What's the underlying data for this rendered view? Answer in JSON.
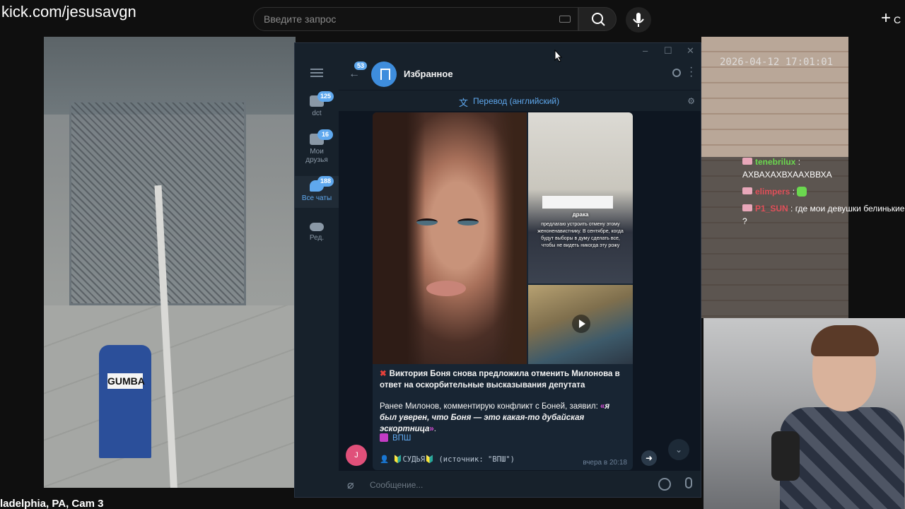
{
  "stream": {
    "url": "kick.com/jesusavgn",
    "cam_caption": "ladelphia, PA, Cam 3",
    "timestamp": "2026-04-12 17:01:01"
  },
  "search": {
    "placeholder": "Введите запрос"
  },
  "browser": {
    "create_label": "С"
  },
  "camera": {
    "mailbox_label": "GUMBA"
  },
  "telegram": {
    "window_controls": [
      "–",
      "☐",
      "✕"
    ],
    "folders": [
      {
        "label": "dct",
        "badge": "125"
      },
      {
        "label": "Мои друзья",
        "badge": "16"
      },
      {
        "label": "Все чаты",
        "badge": "188"
      },
      {
        "label": "Ред.",
        "badge": ""
      }
    ],
    "back_badge": "53",
    "chat_title": "Избранное",
    "translate_label": "Перевод (английский)",
    "message": {
      "headline": "Виктория Боня снова предложила отменить Милонова в ответ на оскорбительные высказывания депутата",
      "body_prefix": "Ранее Милонов, комментирую конфликт с Боней, заявил:",
      "quote": "я был уверен, что Боня — это какая-то дубайская эскортница",
      "link": "ВПШ",
      "signature": "👤 🔰СУДЬЯ🔰 (источник: \"ВПШ\")",
      "time": "вчера в 20:18",
      "photo_caption_title": "драка",
      "photo_caption": "предлагаю устроить отмену этому женоненавистнику. В сентябре, когда будут выборы в думу сделать все, чтобы не видеть никогда эту рожу"
    },
    "sender_initial": "J",
    "input_placeholder": "Сообщение..."
  },
  "chat": [
    {
      "user": "tenebrilux",
      "color": "#6bd84f",
      "text": "АХВАХАХВХААХВВХА"
    },
    {
      "user": "elimpers",
      "color": "#e0505a",
      "text": ""
    },
    {
      "user": "P1_SUN",
      "color": "#e0505a",
      "text": "где мои девушки белинькие ?"
    }
  ],
  "colors": {
    "accent": "#5fa8ee",
    "bg": "#0e1621",
    "panel": "#17212b",
    "bubble": "#182533"
  }
}
